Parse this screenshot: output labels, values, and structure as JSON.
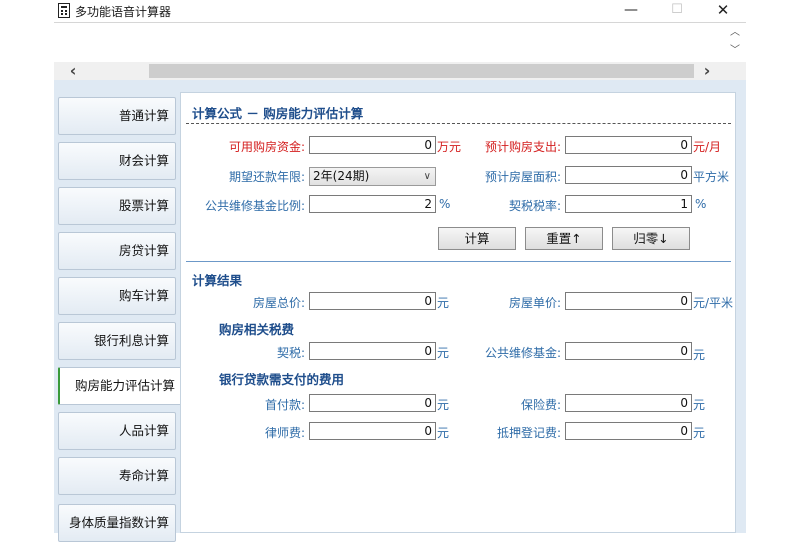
{
  "window": {
    "title": "多功能语音计算器",
    "min": "—",
    "max": "☐",
    "close": "✕"
  },
  "scroll": {
    "up": "︿",
    "down": "﹀",
    "left": "‹",
    "right": "›"
  },
  "sidebar": {
    "items": [
      {
        "label": "普通计算"
      },
      {
        "label": "财会计算"
      },
      {
        "label": "股票计算"
      },
      {
        "label": "房贷计算"
      },
      {
        "label": "购车计算"
      },
      {
        "label": "银行利息计算"
      },
      {
        "label": "购房能力评估计算"
      },
      {
        "label": "人品计算"
      },
      {
        "label": "寿命计算"
      },
      {
        "label": "身体质量指数计算"
      }
    ],
    "active": "购房能力评估计算"
  },
  "formula": {
    "title": "计算公式 － 购房能力评估计算",
    "funds_label": "可用购房资金:",
    "funds_value": "0",
    "funds_unit": "万元",
    "monthly_label": "预计购房支出:",
    "monthly_value": "0",
    "monthly_unit": "元/月",
    "term_label": "期望还款年限:",
    "term_value": "2年(24期)",
    "area_label": "预计房屋面积:",
    "area_value": "0",
    "area_unit": "平方米",
    "fund_ratio_label": "公共维修基金比例:",
    "fund_ratio_value": "2",
    "fund_ratio_unit": "%",
    "deed_tax_label": "契税税率:",
    "deed_tax_value": "1",
    "deed_tax_unit": "%",
    "calc_button": "计算",
    "reset_button": "重置↑",
    "zero_button": "归零↓"
  },
  "results": {
    "title": "计算结果",
    "total_label": "房屋总价:",
    "total_value": "0",
    "total_unit": "元",
    "unit_price_label": "房屋单价:",
    "unit_price_value": "0",
    "unit_price_unit": "元/平米",
    "tax_title": "购房相关税费",
    "deed_label": "契税:",
    "deed_value": "0",
    "deed_unit": "元",
    "maint_label": "公共维修基金:",
    "maint_value": "0",
    "maint_unit": "元",
    "loan_title": "银行贷款需支付的费用",
    "down_label": "首付款:",
    "down_value": "0",
    "down_unit": "元",
    "insurance_label": "保险费:",
    "insurance_value": "0",
    "insurance_unit": "元",
    "lawyer_label": "律师费:",
    "lawyer_value": "0",
    "lawyer_unit": "元",
    "mortgage_label": "抵押登记费:",
    "mortgage_value": "0",
    "mortgage_unit": "元"
  }
}
